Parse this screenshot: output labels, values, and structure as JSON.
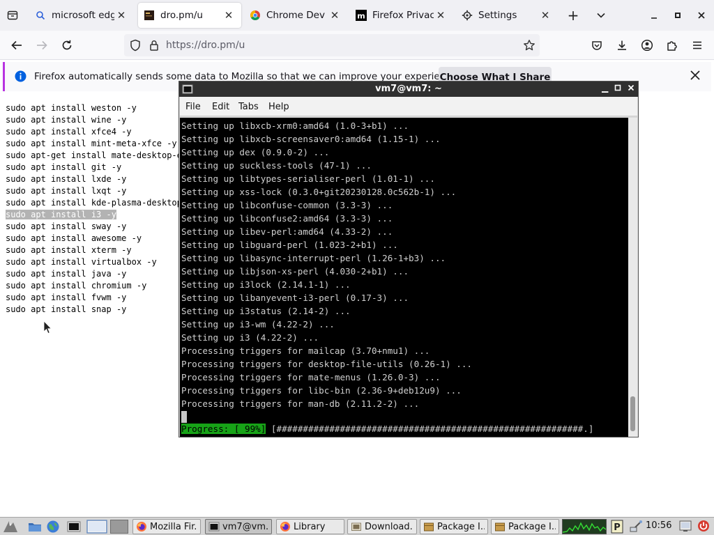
{
  "browser": {
    "tabs": [
      {
        "label": "microsoft edg",
        "icon": "search-icon"
      },
      {
        "label": "dro.pm/u",
        "icon": "site-favicon",
        "active": true
      },
      {
        "label": "Chrome Dev",
        "icon": "chrome-icon"
      },
      {
        "label": "Firefox Privacy",
        "icon": "mozilla-m-icon"
      },
      {
        "label": "Settings",
        "icon": "gear-icon"
      }
    ],
    "url_prefix": "https://",
    "url_host": "dro.pm/u",
    "notification": {
      "text": "Firefox automatically sends some data to Mozilla so that we can improve your experience.",
      "button": "Choose What I Share"
    }
  },
  "page": {
    "lines": [
      "sudo apt install weston -y",
      "sudo apt install wine -y",
      "sudo apt install xfce4 -y",
      "sudo apt install mint-meta-xfce -y",
      "sudo apt-get install mate-desktop-environment -y",
      "sudo apt install git -y",
      "sudo apt install lxde -y",
      "sudo apt install lxqt -y",
      "sudo apt install kde-plasma-desktop -y",
      "sudo apt install i3 -y",
      "sudo apt install sway -y",
      "sudo apt install awesome -y",
      "sudo apt install xterm -y",
      "sudo apt install virtualbox -y",
      "sudo apt install java -y",
      "sudo apt install chromium -y",
      "sudo apt install fvwm -y",
      "sudo apt install snap -y"
    ],
    "selected_index": 9
  },
  "terminal": {
    "title": "vm7@vm7: ~",
    "menu": [
      "File",
      "Edit",
      "Tabs",
      "Help"
    ],
    "lines": [
      "Setting up libxcb-xrm0:amd64 (1.0-3+b1) ...",
      "Setting up libxcb-screensaver0:amd64 (1.15-1) ...",
      "Setting up dex (0.9.0-2) ...",
      "Setting up suckless-tools (47-1) ...",
      "Setting up libtypes-serialiser-perl (1.01-1) ...",
      "Setting up xss-lock (0.3.0+git20230128.0c562b-1) ...",
      "Setting up libconfuse-common (3.3-3) ...",
      "Setting up libconfuse2:amd64 (3.3-3) ...",
      "Setting up libev-perl:amd64 (4.33-2) ...",
      "Setting up libguard-perl (1.023-2+b1) ...",
      "Setting up libasync-interrupt-perl (1.26-1+b3) ...",
      "Setting up libjson-xs-perl (4.030-2+b1) ...",
      "Setting up i3lock (2.14.1-1) ...",
      "Setting up libanyevent-i3-perl (0.17-3) ...",
      "Setting up i3status (2.14-2) ...",
      "Setting up i3-wm (4.22-2) ...",
      "Setting up i3 (4.22-2) ...",
      "Processing triggers for mailcap (3.70+nmu1) ...",
      "Processing triggers for desktop-file-utils (0.26-1) ...",
      "Processing triggers for mate-menus (1.26.0-3) ...",
      "Processing triggers for libc-bin (2.36-9+deb12u9) ...",
      "Processing triggers for man-db (2.11.2-2) ..."
    ],
    "progress_label": "Progress: [ 99%]",
    "progress_bar": " [##########################################################.]",
    "progress_value": 0.99
  },
  "taskbar": {
    "tasks": [
      {
        "label": "Mozilla Fir...",
        "icon": "firefox-icon"
      },
      {
        "label": "vm7@vm...",
        "icon": "terminal-icon",
        "active": true
      },
      {
        "label": "Library",
        "icon": "firefox-icon"
      },
      {
        "label": "Download...",
        "icon": "folder-icon"
      },
      {
        "label": "Package I...",
        "icon": "package-icon"
      },
      {
        "label": "Package I...",
        "icon": "package-icon"
      }
    ],
    "clock": "10:56"
  }
}
